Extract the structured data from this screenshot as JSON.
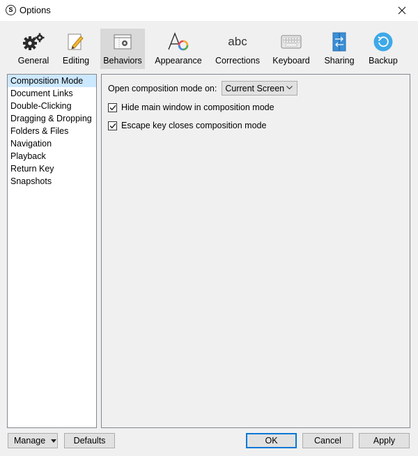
{
  "window": {
    "title": "Options",
    "app_icon_letter": "S"
  },
  "toolbar": {
    "items": [
      {
        "label": "General",
        "icon": "gears-icon"
      },
      {
        "label": "Editing",
        "icon": "edit-pencil-icon"
      },
      {
        "label": "Behaviors",
        "icon": "behaviors-window-icon",
        "selected": true
      },
      {
        "label": "Appearance",
        "icon": "appearance-font-icon"
      },
      {
        "label": "Corrections",
        "icon": "corrections-abc-icon",
        "glyph": "abc"
      },
      {
        "label": "Keyboard",
        "icon": "keyboard-icon"
      },
      {
        "label": "Sharing",
        "icon": "sharing-icon"
      },
      {
        "label": "Backup",
        "icon": "backup-icon"
      }
    ]
  },
  "sidebar": {
    "items": [
      {
        "label": "Composition Mode",
        "selected": true
      },
      {
        "label": "Document Links"
      },
      {
        "label": "Double-Clicking"
      },
      {
        "label": "Dragging & Dropping"
      },
      {
        "label": "Folders & Files"
      },
      {
        "label": "Navigation"
      },
      {
        "label": "Playback"
      },
      {
        "label": "Return Key"
      },
      {
        "label": "Snapshots"
      }
    ]
  },
  "panel": {
    "open_mode_label": "Open composition mode on:",
    "open_mode_value": "Current Screen",
    "hide_main_window_label": "Hide main window in composition mode",
    "hide_main_window_checked": true,
    "escape_key_label": "Escape key closes composition mode",
    "escape_key_checked": true
  },
  "footer": {
    "manage_label": "Manage",
    "defaults_label": "Defaults",
    "ok_label": "OK",
    "cancel_label": "Cancel",
    "apply_label": "Apply"
  },
  "colors": {
    "selection": "#cce8ff",
    "toolbar_selected": "#d9d9d9",
    "default_button_border": "#0078d7",
    "backup_blue": "#3fa9e8",
    "sharing_blue": "#3a8fd6"
  }
}
